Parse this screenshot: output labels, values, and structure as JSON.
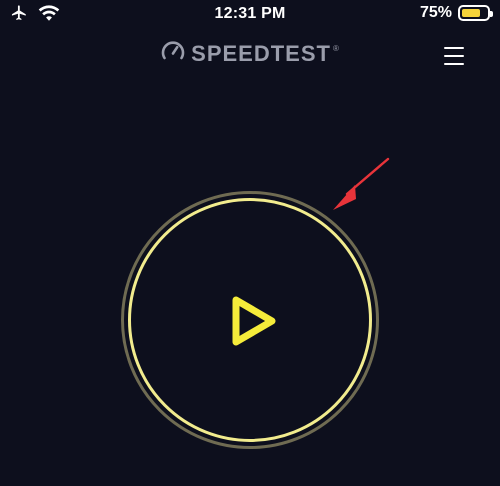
{
  "status_bar": {
    "time": "12:31 PM",
    "battery_percent": "75%",
    "battery_level": 0.75,
    "icons": [
      "airplane-icon",
      "wifi-icon",
      "battery-icon"
    ]
  },
  "header": {
    "brand": "SPEEDTEST",
    "trademark": "®",
    "icons": [
      "speedometer-icon",
      "menu-icon"
    ]
  },
  "go_button": {
    "icon": "play-icon",
    "ring_color": "#f2ec8e",
    "outer_ring_color": "#6f6b52",
    "play_color": "#f5ec3a"
  },
  "annotation": {
    "icon": "red-arrow-icon",
    "color": "#e8343a"
  },
  "colors": {
    "background": "#0d0f1d",
    "accent": "#f5d33a"
  }
}
